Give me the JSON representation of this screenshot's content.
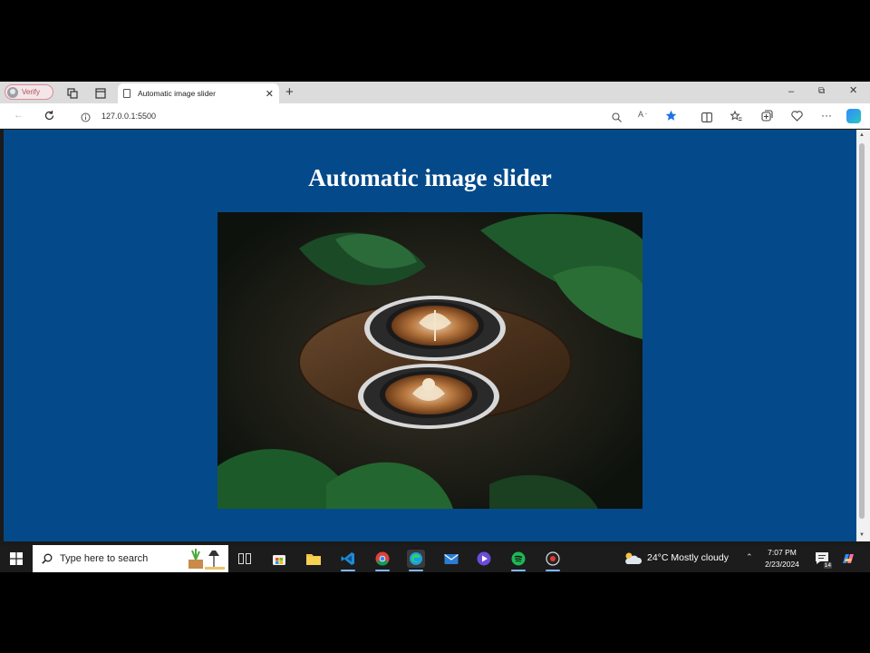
{
  "browser": {
    "profile_label": "Verify",
    "tab_title": "Automatic image slider",
    "url": "127.0.0.1:5500",
    "icons": {
      "workspaces": "workspaces-icon",
      "tab_actions": "tab-actions-icon",
      "new_tab": "+",
      "minimize": "–",
      "restore": "⧉",
      "close": "✕"
    }
  },
  "page": {
    "title": "Automatic image slider",
    "background_color": "#044a8a",
    "slide_alt": "latte art coffee cups"
  },
  "taskbar": {
    "search_placeholder": "Type here to search",
    "weather": "24°C  Mostly cloudy",
    "time": "7:07 PM",
    "date": "2/23/2024",
    "notification_count": "14"
  }
}
